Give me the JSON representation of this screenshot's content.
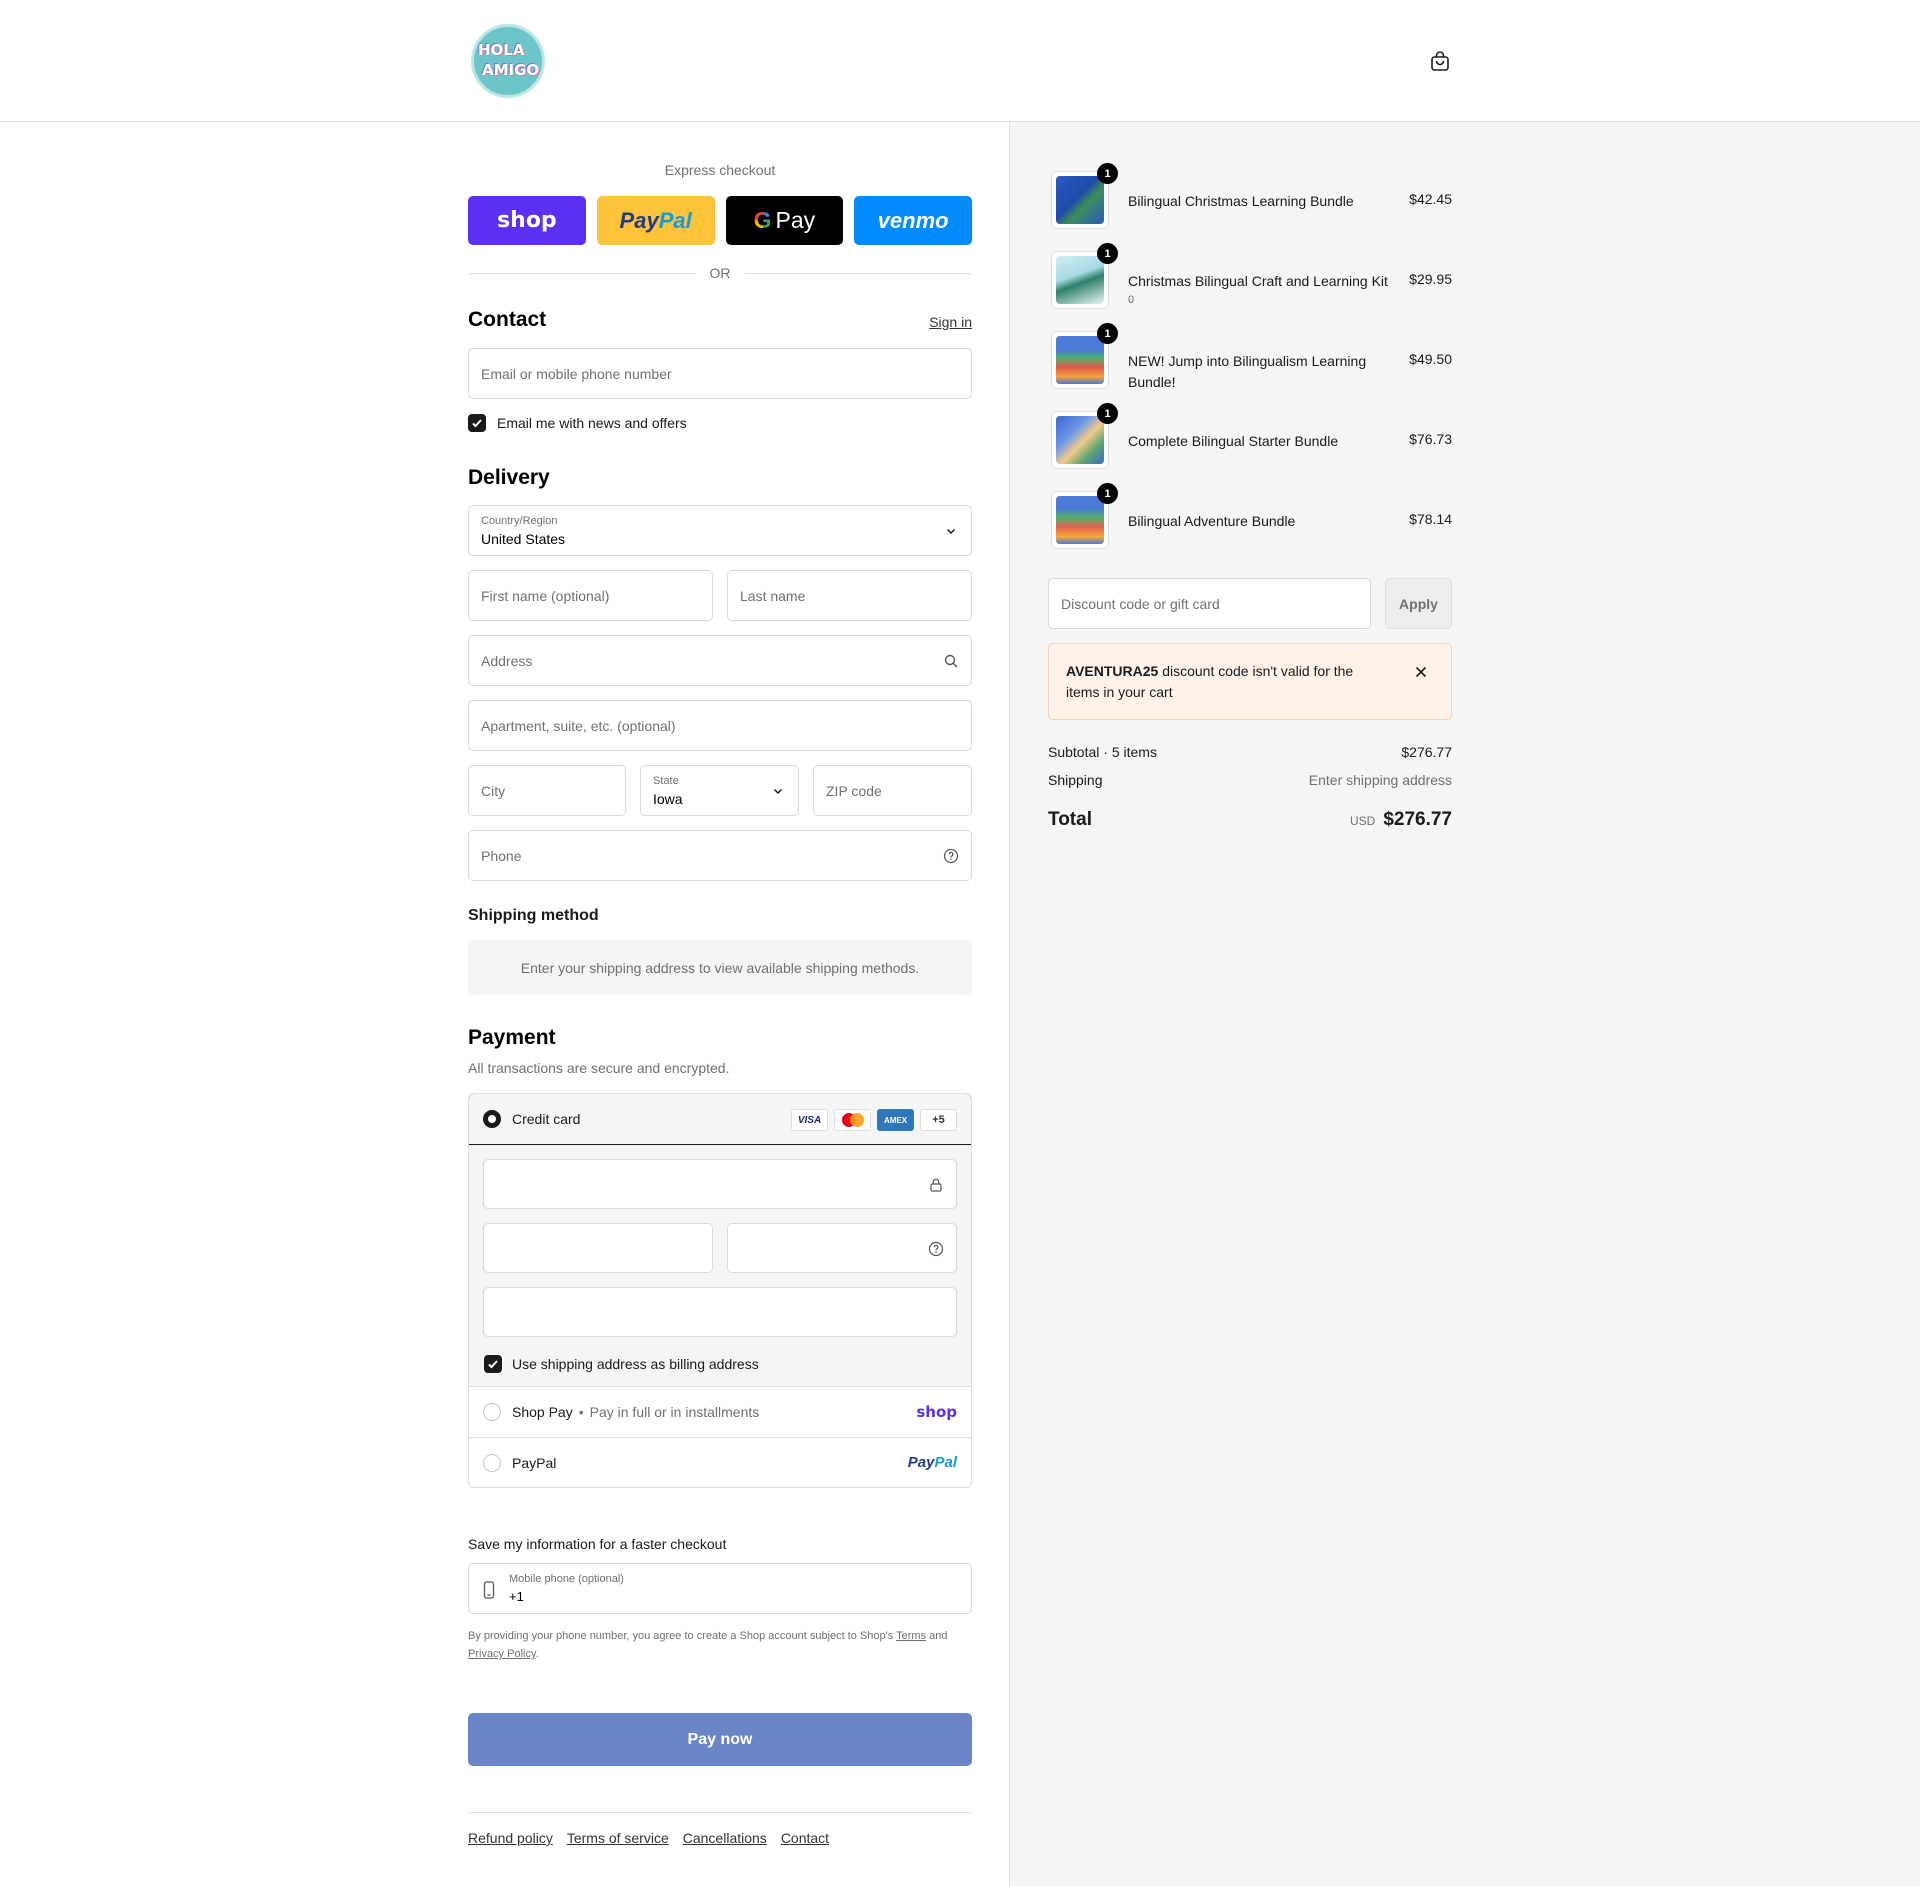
{
  "header": {
    "logo_text_1": "HOLA",
    "logo_text_2": "AMIGO",
    "cart_icon": "shopping-bag-icon"
  },
  "express": {
    "label": "Express checkout",
    "shop_label": "shop",
    "paypal_label_1": "Pay",
    "paypal_label_2": "Pal",
    "gpay_g": "G",
    "gpay_label": "Pay",
    "venmo_label": "venmo",
    "or": "OR"
  },
  "contact": {
    "title": "Contact",
    "signin": "Sign in",
    "email_placeholder": "Email or mobile phone number",
    "news_label": "Email me with news and offers",
    "news_checked": true
  },
  "delivery": {
    "title": "Delivery",
    "country_label": "Country/Region",
    "country_value": "United States",
    "first_name_placeholder": "First name (optional)",
    "last_name_placeholder": "Last name",
    "address_placeholder": "Address",
    "apartment_placeholder": "Apartment, suite, etc. (optional)",
    "city_placeholder": "City",
    "state_label": "State",
    "state_value": "Iowa",
    "zip_placeholder": "ZIP code",
    "phone_placeholder": "Phone"
  },
  "shipping_method": {
    "title": "Shipping method",
    "message": "Enter your shipping address to view available shipping methods."
  },
  "payment": {
    "title": "Payment",
    "subtitle": "All transactions are secure and encrypted.",
    "credit_card_label": "Credit card",
    "card_visa": "VISA",
    "card_amex": "AMEX",
    "card_more": "+5",
    "billing_label": "Use shipping address as billing address",
    "billing_checked": true,
    "shop_pay_label": "Shop Pay",
    "shop_pay_sub": "Pay in full or in installments",
    "shop_pay_brand": "shop",
    "paypal_label": "PayPal",
    "paypal_brand_1": "Pay",
    "paypal_brand_2": "Pal"
  },
  "save_info": {
    "title": "Save my information for a faster checkout",
    "phone_label": "Mobile phone (optional)",
    "phone_value": "+1",
    "legal_prefix": "By providing your phone number, you agree to create a Shop account subject to Shop's ",
    "legal_terms": "Terms",
    "legal_and": " and ",
    "legal_privacy": "Privacy Policy",
    "legal_suffix": "."
  },
  "pay_now": "Pay now",
  "footer": [
    "Refund policy",
    "Terms of service",
    "Cancellations",
    "Contact"
  ],
  "cart": {
    "items": [
      {
        "name": "Bilingual Christmas Learning Bundle",
        "sub": "",
        "qty": "1",
        "price": "$42.45"
      },
      {
        "name": "Christmas Bilingual Craft and Learning Kit",
        "sub": "0",
        "qty": "1",
        "price": "$29.95"
      },
      {
        "name": "NEW! Jump into Bilingualism Learning Bundle!",
        "sub": "",
        "qty": "1",
        "price": "$49.50"
      },
      {
        "name": "Complete Bilingual Starter Bundle",
        "sub": "",
        "qty": "1",
        "price": "$76.73"
      },
      {
        "name": "Bilingual Adventure Bundle",
        "sub": "",
        "qty": "1",
        "price": "$78.14"
      }
    ],
    "discount_placeholder": "Discount code or gift card",
    "apply": "Apply",
    "alert_code": "AVENTURA25",
    "alert_text": " discount code isn't valid for the items in your cart",
    "subtotal_label": "Subtotal · 5 items",
    "subtotal_value": "$276.77",
    "shipping_label": "Shipping",
    "shipping_value": "Enter shipping address",
    "total_label": "Total",
    "currency": "USD",
    "total_value": "$276.77"
  },
  "colors": {
    "shop_purple": "#5a31f4",
    "paypal_yellow": "#ffc439",
    "venmo_blue": "#008cff",
    "pay_now": "#6a86c6",
    "alert_bg": "#fff3e9"
  }
}
